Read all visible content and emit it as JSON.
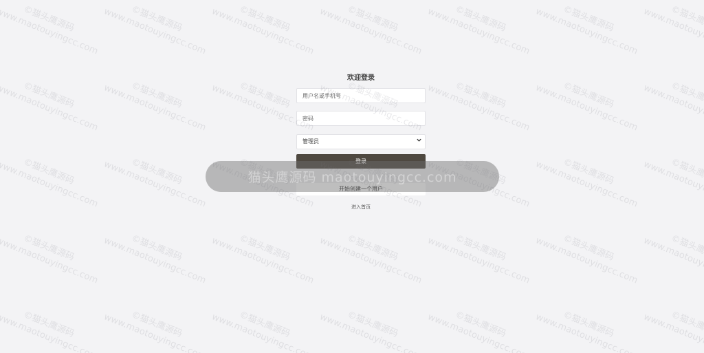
{
  "login": {
    "title": "欢迎登录",
    "username_placeholder": "用户名或手机号",
    "password_placeholder": "密码",
    "role_selected": "管理员",
    "login_label": "登录",
    "register_label": "开始创建一个用户",
    "home_label": "进入首页"
  },
  "watermark": {
    "tile_line1": "©猫头鹰源码",
    "tile_line2": "www.maotouyingcc.com",
    "banner": "猫头鹰源码 maotouyingcc.com"
  },
  "colors": {
    "background": "#f3f3f5",
    "button": "#4e4840"
  }
}
